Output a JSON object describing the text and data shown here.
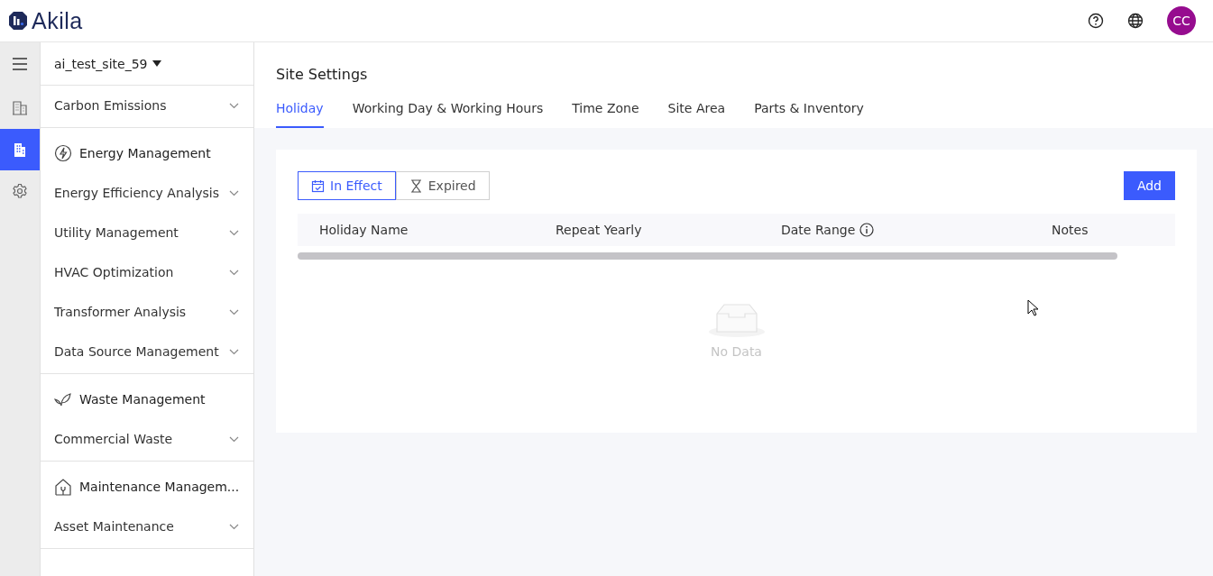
{
  "header": {
    "logo": "Akila",
    "avatar": "CC"
  },
  "rail": [
    {
      "kind": "menu",
      "selected": false
    },
    {
      "kind": "building",
      "selected": false
    },
    {
      "kind": "site",
      "selected": true
    },
    {
      "kind": "settings",
      "selected": false
    }
  ],
  "site_selector": "ai_test_site_59",
  "nav_sections": [
    {
      "items": [
        "Carbon Emissions"
      ]
    },
    {
      "header": {
        "label": "Energy Management",
        "kind": "bolt"
      },
      "items": [
        "Energy Efficiency Analysis",
        "Utility Management",
        "HVAC Optimization",
        "Transformer Analysis",
        "Data Source Management"
      ]
    },
    {
      "header": {
        "label": "Waste Management",
        "kind": "leaf"
      },
      "items": [
        "Commercial Waste"
      ]
    },
    {
      "header": {
        "label": "Maintenance Managem...",
        "kind": "house"
      },
      "items": [
        "Asset Maintenance"
      ]
    }
  ],
  "page_title": "Site Settings",
  "tabs": [
    {
      "label": "Holiday",
      "selected": true
    },
    {
      "label": "Working Day & Working Hours",
      "selected": false
    },
    {
      "label": "Time Zone",
      "selected": false
    },
    {
      "label": "Site Area",
      "selected": false
    },
    {
      "label": "Parts & Inventory",
      "selected": false
    }
  ],
  "filters": [
    {
      "label": "In Effect",
      "kind": "calendar",
      "selected": true
    },
    {
      "label": "Expired",
      "kind": "hourglass",
      "selected": false
    }
  ],
  "add_button": "Add",
  "table": {
    "columns": [
      {
        "label": "Holiday Name"
      },
      {
        "label": "Repeat Yearly"
      },
      {
        "label": "Date Range",
        "info": true
      },
      {
        "label": "Notes"
      }
    ],
    "empty_text": "No Data"
  }
}
